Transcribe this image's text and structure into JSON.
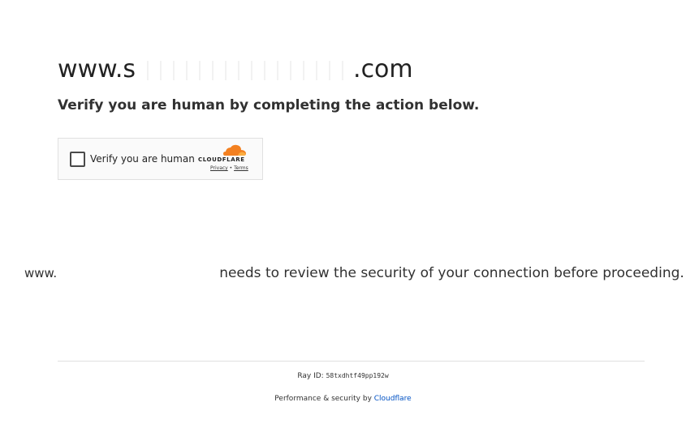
{
  "site": {
    "title_prefix": "www.s",
    "title_suffix": ".com"
  },
  "headline": "Verify you are human by completing the action below.",
  "widget": {
    "checkbox_label": "Verify you are human",
    "brand": "CLOUDFLARE",
    "privacy_link": "Privacy",
    "link_separator": " • ",
    "terms_link": "Terms",
    "brand_color": "#f38020"
  },
  "review": {
    "domain_prefix": "www.",
    "message": "needs to review the security of your connection before proceeding."
  },
  "footer": {
    "ray_label": "Ray ID: ",
    "ray_id": "58txdhtf49pp192w",
    "performance_text": "Performance & security by ",
    "cloudflare_link": "Cloudflare",
    "link_color": "#0051c3"
  }
}
